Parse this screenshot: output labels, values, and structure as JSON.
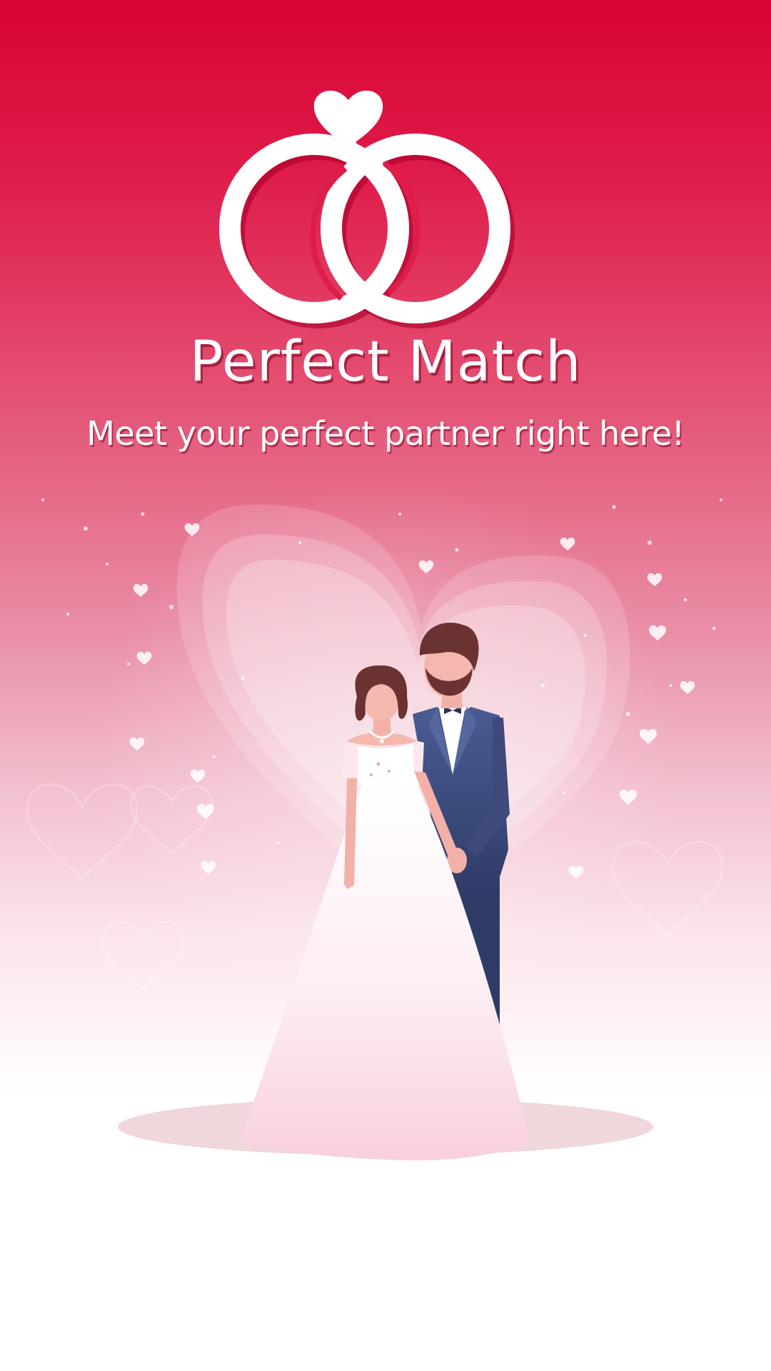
{
  "app": {
    "title": "Perfect Match",
    "tagline": "Meet your perfect partner right here!"
  },
  "colors": {
    "brand_red": "#d90432",
    "blush_pink": "#e98ea6",
    "suit_navy": "#3d4a7a",
    "dress_pink": "#f9d2e0",
    "hair_brown": "#6b3232"
  },
  "icons": {
    "logo": "wedding-rings-heart-icon",
    "illustration": "bride-and-groom-illustration"
  }
}
